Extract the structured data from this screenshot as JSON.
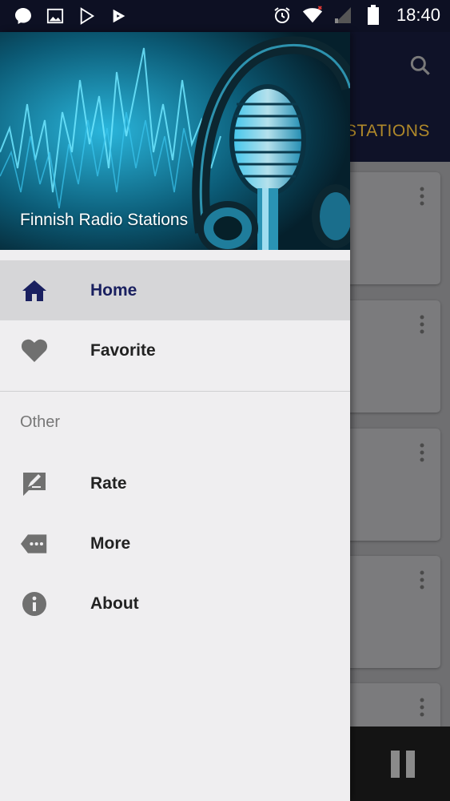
{
  "status_bar": {
    "time": "18:40",
    "left_icons": [
      "messenger-icon",
      "gallery-icon",
      "play-store-icon",
      "play-games-icon"
    ],
    "right_icons": [
      "alarm-icon",
      "wifi-icon",
      "signal-icon",
      "battery-icon"
    ]
  },
  "background": {
    "tab_label": "STATIONS",
    "card_count": 5
  },
  "drawer": {
    "header_title": "Finnish Radio Stations",
    "items": [
      {
        "label": "Home",
        "icon": "home-icon",
        "active": true
      },
      {
        "label": "Favorite",
        "icon": "heart-icon",
        "active": false
      }
    ],
    "section_title": "Other",
    "other_items": [
      {
        "label": "Rate",
        "icon": "rate-icon"
      },
      {
        "label": "More",
        "icon": "more-icon"
      },
      {
        "label": "About",
        "icon": "info-icon"
      }
    ]
  },
  "colors": {
    "accent": "#1a2060",
    "tab_text": "#b0892a",
    "header_glow": "#2ec8f0"
  }
}
